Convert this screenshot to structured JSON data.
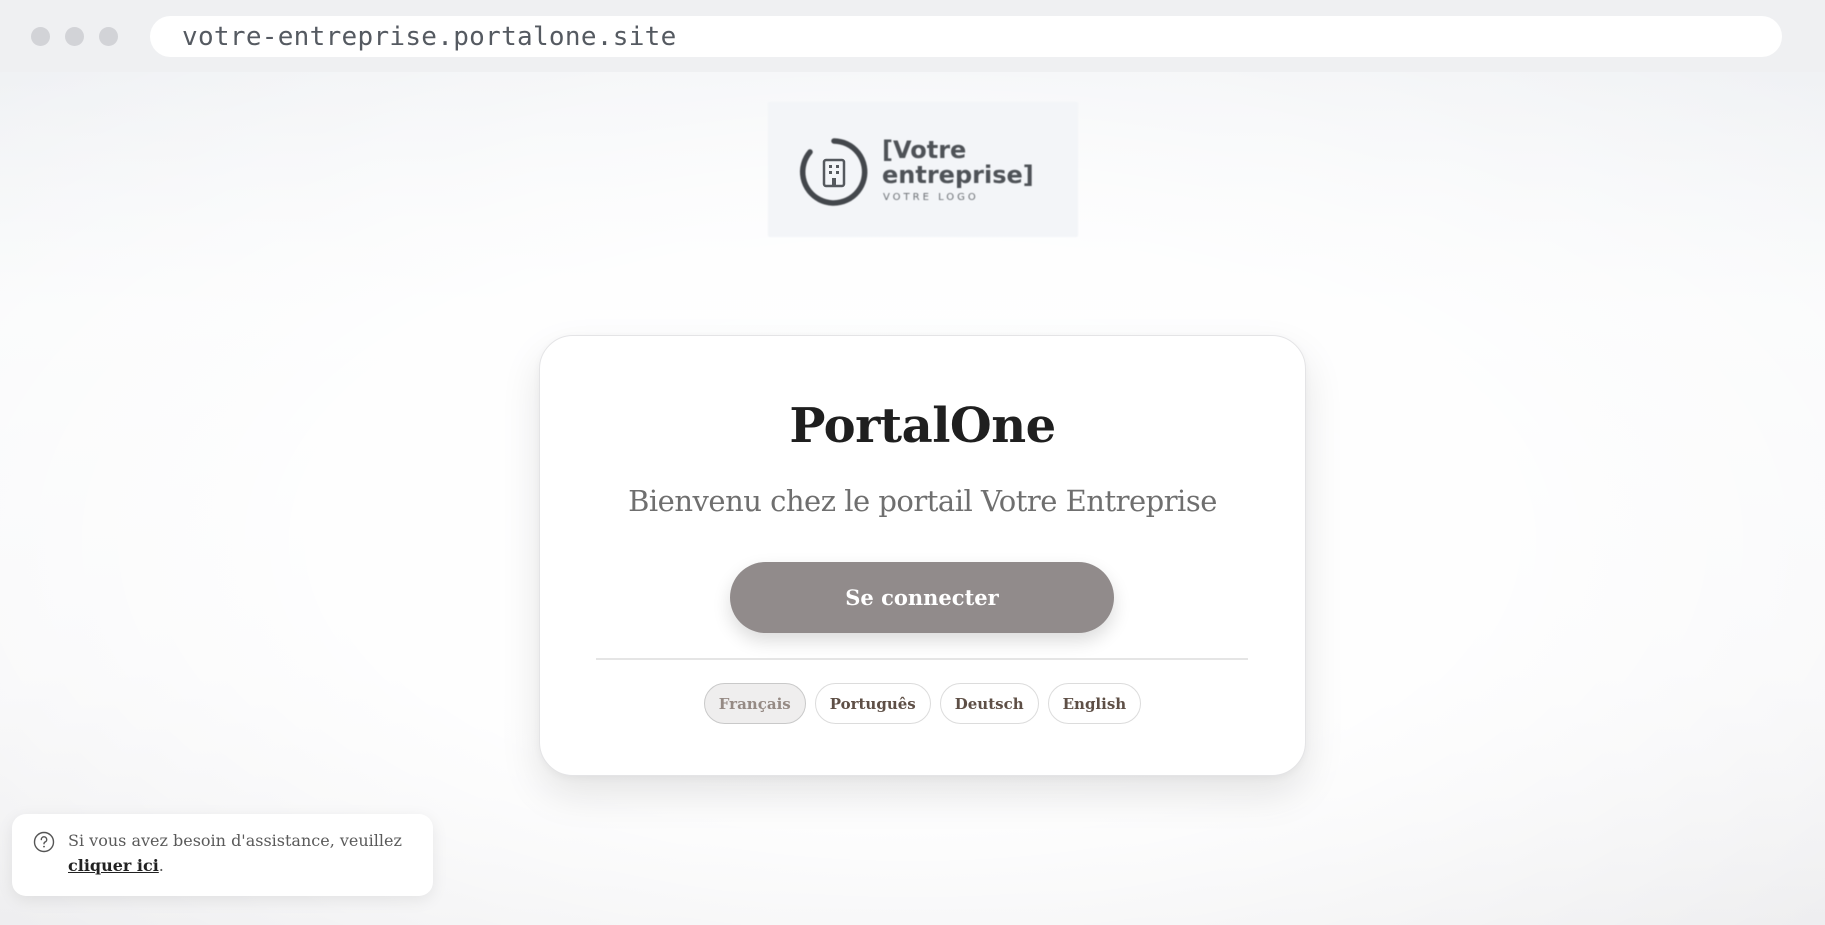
{
  "browser": {
    "url": "votre-entreprise.portalone.site"
  },
  "logo": {
    "line1": "[Votre",
    "line2": "entreprise]",
    "tagline": "VOTRE LOGO"
  },
  "card": {
    "title": "PortalOne",
    "subtitle": "Bienvenu chez le portail Votre Entreprise",
    "login_label": "Se connecter",
    "languages": [
      {
        "label": "Français",
        "active": true
      },
      {
        "label": "Português",
        "active": false
      },
      {
        "label": "Deutsch",
        "active": false
      },
      {
        "label": "English",
        "active": false
      }
    ]
  },
  "help": {
    "text_before": "Si vous avez besoin d'assistance, veuillez",
    "link_text": "cliquer ici",
    "text_after": "."
  },
  "colors": {
    "button_bg": "#918b8b",
    "title": "#1f1f1f"
  }
}
